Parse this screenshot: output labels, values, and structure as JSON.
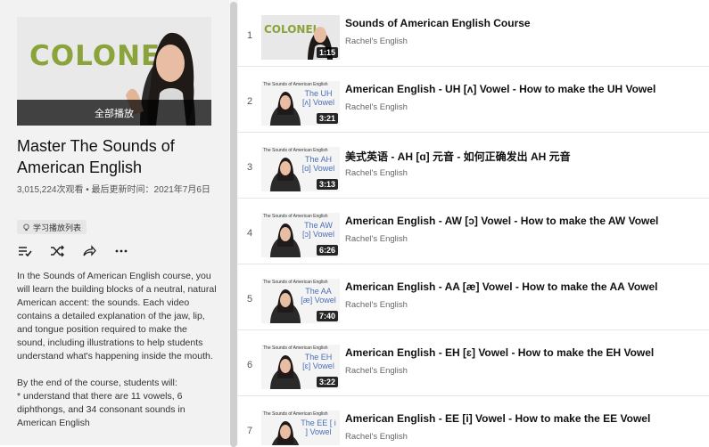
{
  "playlist": {
    "play_all_label": "全部播放",
    "hero_word": "COLONEL",
    "title": "Master The Sounds of American English",
    "meta": "3,015,224次观看 • 最后更新时间：2021年7月6日",
    "badge": "学习播放列表",
    "actions": [
      "add-to-queue-icon",
      "shuffle-icon",
      "share-icon",
      "more-icon"
    ],
    "description": "In the Sounds of American English course, you will learn the building blocks of a neutral, natural American accent:  the sounds.  Each video contains a detailed explanation of the jaw, lip, and tongue position required to make the sound, including illustrations to help students understand what's happening inside the mouth.\n\nBy the end of the course, students will:\n* understand that there are 11 vowels, 6 diphthongs, and 34 consonant sounds in American English"
  },
  "colors": {
    "accent": "#8aa33a",
    "thumb_text": "#4a6fb5"
  },
  "videos": [
    {
      "index": "1",
      "title": "Sounds of American English Course",
      "channel": "Rachel's English",
      "duration": "1:15",
      "thumb_word": "COLONEL"
    },
    {
      "index": "2",
      "title": "American English - UH [ʌ] Vowel - How to make the UH Vowel",
      "channel": "Rachel's English",
      "duration": "3:21",
      "series": "The Sounds of American English",
      "thumb_label": "The UH [ʌ] Vowel"
    },
    {
      "index": "3",
      "title": "美式英语 - AH [ɑ] 元音 - 如何正确发出 AH 元音",
      "channel": "Rachel's English",
      "duration": "3:13",
      "series": "The Sounds of American English",
      "thumb_label": "The AH [ɑ] Vowel"
    },
    {
      "index": "4",
      "title": "American English - AW [ɔ] Vowel - How to make the AW Vowel",
      "channel": "Rachel's English",
      "duration": "6:26",
      "series": "The Sounds of American English",
      "thumb_label": "The AW [ɔ] Vowel"
    },
    {
      "index": "5",
      "title": "American English - AA [æ] Vowel - How to make the AA Vowel",
      "channel": "Rachel's English",
      "duration": "7:40",
      "series": "The Sounds of American English",
      "thumb_label": "The AA [æ] Vowel"
    },
    {
      "index": "6",
      "title": "American English - EH [ɛ] Vowel - How to make the EH Vowel",
      "channel": "Rachel's English",
      "duration": "3:22",
      "series": "The Sounds of American English",
      "thumb_label": "The EH [ɛ] Vowel"
    },
    {
      "index": "7",
      "title": "American English - EE [i] Vowel - How to make the EE Vowel",
      "channel": "Rachel's English",
      "duration": "",
      "series": "The Sounds of American English",
      "thumb_label": "The EE [ i ] Vowel"
    }
  ]
}
